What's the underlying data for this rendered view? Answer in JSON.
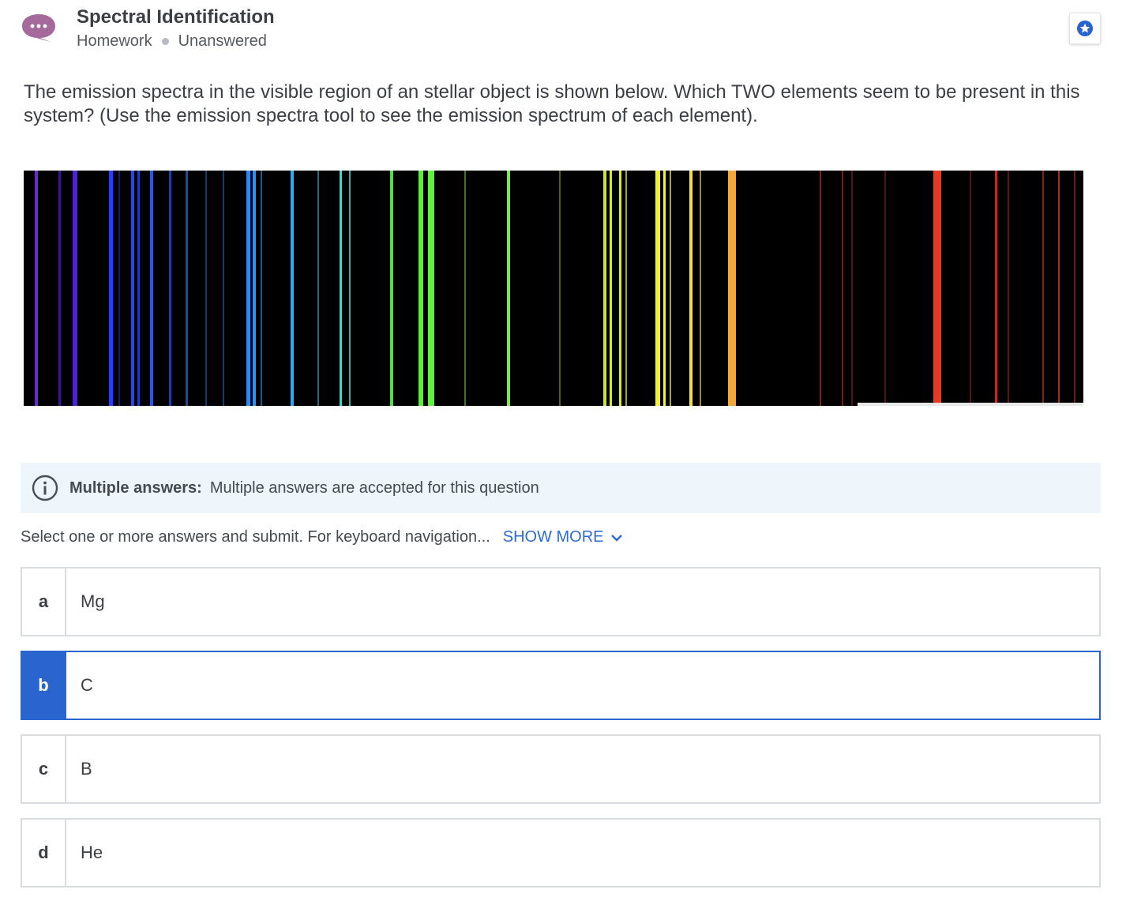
{
  "header": {
    "title": "Spectral Identification",
    "category": "Homework",
    "status": "Unanswered",
    "chat_icon": "chat-bubble-icon",
    "star_icon": "star-icon"
  },
  "question": {
    "text": "The emission spectra in the visible region of an stellar object is shown below. Which TWO elements seem to be present in this system? (Use the emission spectra tool to see the emission spectrum of each element)."
  },
  "info": {
    "icon": "info-icon",
    "label": "Multiple answers:",
    "text": "Multiple answers are accepted for this question"
  },
  "instructions": {
    "text": "Select one or more answers and submit. For keyboard navigation...",
    "show_more": "SHOW MORE"
  },
  "answers": [
    {
      "letter": "a",
      "label": "Mg",
      "selected": false
    },
    {
      "letter": "b",
      "label": "C",
      "selected": true
    },
    {
      "letter": "c",
      "label": "B",
      "selected": false
    },
    {
      "letter": "d",
      "label": "He",
      "selected": false
    }
  ],
  "colors": {
    "accent": "#2a65cf",
    "chat_icon": "#a56a9b",
    "banner_bg": "#eef5fb"
  }
}
